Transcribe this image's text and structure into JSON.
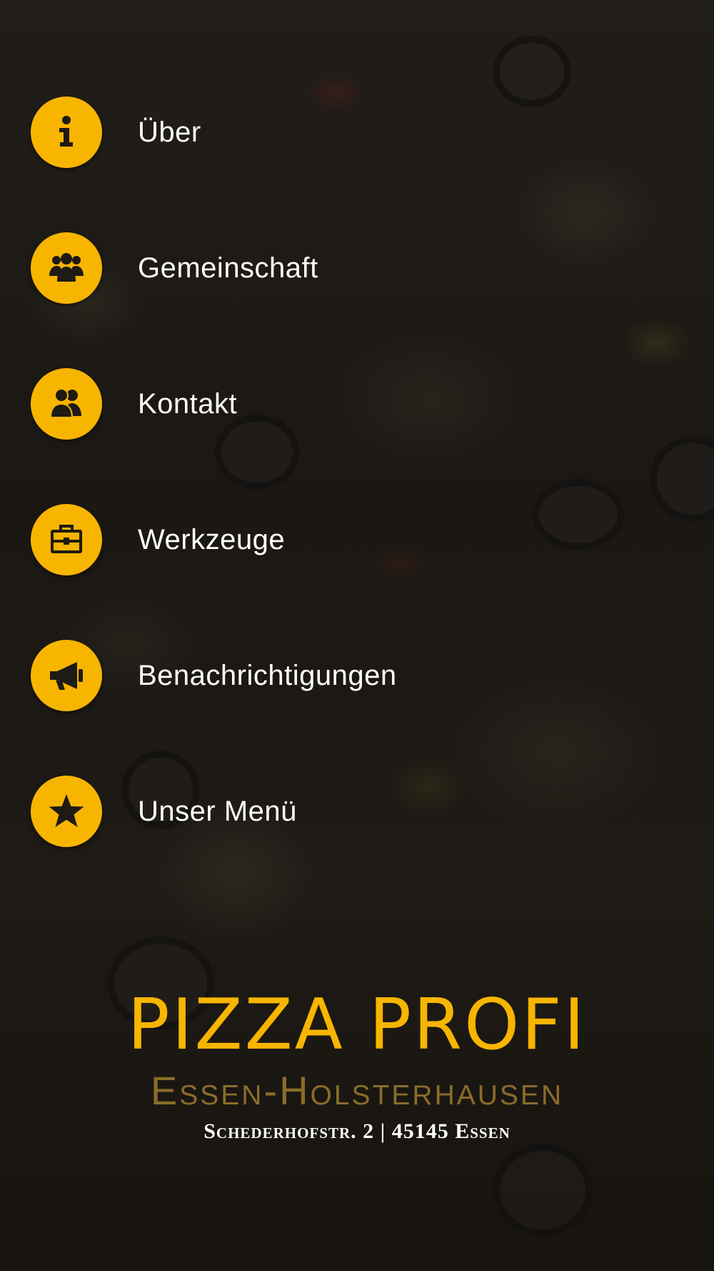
{
  "menu": {
    "items": [
      {
        "label": "Über",
        "icon": "info-icon"
      },
      {
        "label": "Gemeinschaft",
        "icon": "group-icon"
      },
      {
        "label": "Kontakt",
        "icon": "contacts-icon"
      },
      {
        "label": "Werkzeuge",
        "icon": "briefcase-icon"
      },
      {
        "label": "Benachrichtigungen",
        "icon": "megaphone-icon"
      },
      {
        "label": "Unser Menü",
        "icon": "star-icon"
      }
    ]
  },
  "brand": {
    "title": "PIZZA PROFI",
    "subtitle": "Essen-Holsterhausen",
    "address": "Schederhofstr. 2 | 45145 Essen"
  },
  "colors": {
    "accent": "#f8b500",
    "icon_glyph": "#1e1a14",
    "label": "#ffffff",
    "subtitle": "#8a6c2a",
    "background": "#1a1612"
  }
}
